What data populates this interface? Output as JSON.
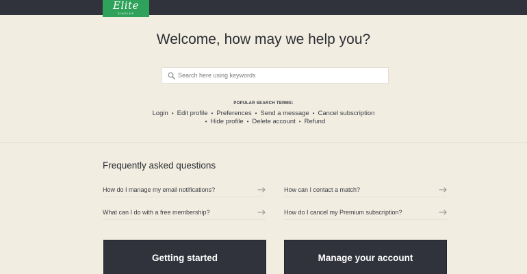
{
  "header": {
    "logo_word": "Elite",
    "logo_sub": "SINGLES"
  },
  "hero": {
    "title": "Welcome, how may we help you?",
    "search_placeholder": "Search here using keywords",
    "search_value": ""
  },
  "popular": {
    "label": "POPULAR SEARCH TERMS:",
    "line1": [
      "Login",
      "Edit profile",
      "Preferences",
      "Send a message",
      "Cancel subscription"
    ],
    "line2": [
      "Hide profile",
      "Delete account",
      "Refund"
    ]
  },
  "faq": {
    "title": "Frequently asked questions",
    "items": [
      "How do I manage my email notifications?",
      "How can I contact a match?",
      "What can I do with a free membership?",
      "How do I cancel my Premium subscription?"
    ]
  },
  "cards": [
    "Getting started",
    "Manage your account"
  ],
  "colors": {
    "background": "#f2ede1",
    "header": "#30333b",
    "brand": "#2ea25a",
    "card": "#30333b"
  },
  "icons": {
    "search": "magnifier-icon",
    "faq_link": "arrow-right-icon"
  }
}
